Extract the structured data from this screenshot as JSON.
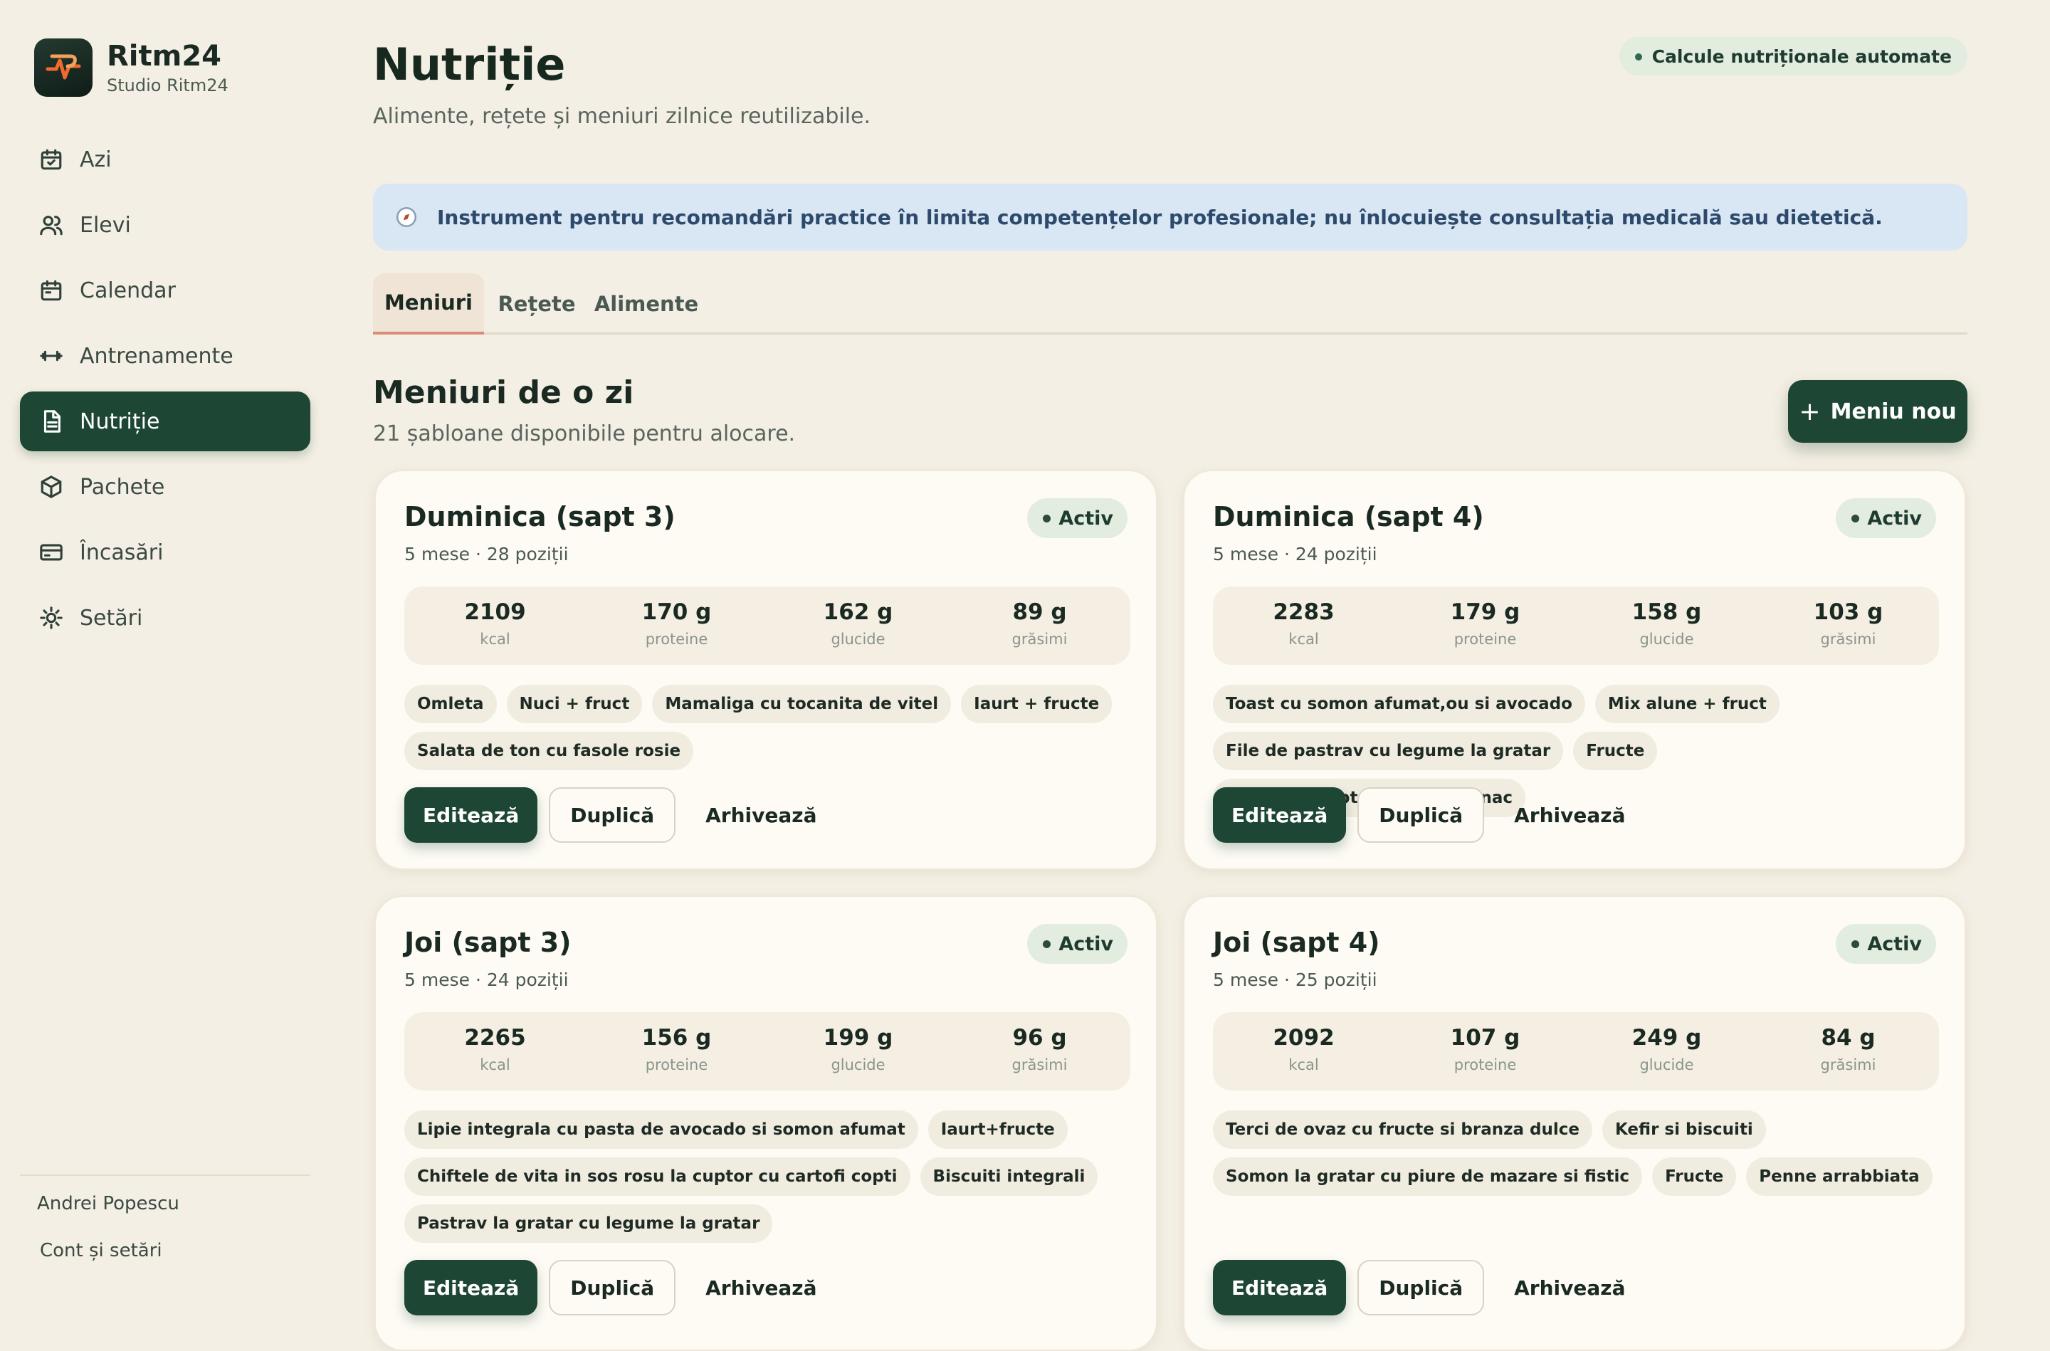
{
  "brand": {
    "name": "Ritm24",
    "subtitle": "Studio Ritm24"
  },
  "sidebar": {
    "items": [
      {
        "label": "Azi",
        "icon": "calendar-check-icon"
      },
      {
        "label": "Elevi",
        "icon": "users-icon"
      },
      {
        "label": "Calendar",
        "icon": "calendar-icon"
      },
      {
        "label": "Antrenamente",
        "icon": "dumbbell-icon"
      },
      {
        "label": "Nutriție",
        "icon": "document-icon",
        "active": true
      },
      {
        "label": "Pachete",
        "icon": "package-icon"
      },
      {
        "label": "Încasări",
        "icon": "credit-card-icon"
      },
      {
        "label": "Setări",
        "icon": "sun-gear-icon"
      }
    ],
    "user_name": "Andrei Popescu",
    "account_link": "Cont și setări"
  },
  "header": {
    "title": "Nutriție",
    "subtitle": "Alimente, rețete și meniuri zilnice reutilizabile.",
    "badge": "Calcule nutriționale automate"
  },
  "notice": {
    "text": "Instrument pentru recomandări practice în limita competențelor profesionale; nu înlocuiește consultația medicală sau dietetică."
  },
  "tabs": [
    {
      "label": "Meniuri",
      "active": true
    },
    {
      "label": "Rețete"
    },
    {
      "label": "Alimente"
    }
  ],
  "section": {
    "title": "Meniuri de o zi",
    "subtitle": "21 șabloane disponibile pentru alocare.",
    "new_button": "Meniu nou",
    "new_button_icon": "+"
  },
  "stat_labels": {
    "kcal": "kcal",
    "protein": "proteine",
    "carbs": "glucide",
    "fat": "grăsimi"
  },
  "actions": {
    "edit": "Editează",
    "duplicate": "Duplică",
    "archive": "Arhivează"
  },
  "menus": [
    {
      "title": "Duminica (sapt 3)",
      "meta": "5 mese · 28 poziții",
      "status": "Activ",
      "kcal": "2109",
      "protein": "170 g",
      "carbs": "162 g",
      "fat": "89 g",
      "meals": [
        "Omleta",
        "Nuci + fruct",
        "Mamaliga cu tocanita de vitel",
        "Iaurt + fructe",
        "Salata de ton cu fasole rosie"
      ]
    },
    {
      "title": "Duminica (sapt 4)",
      "meta": "5 mese · 24 poziții",
      "status": "Activ",
      "kcal": "2283",
      "protein": "179 g",
      "carbs": "158 g",
      "fat": "103 g",
      "meals": [
        "Toast cu somon afumat,ou si avocado",
        "Mix alune + fruct",
        "File de pastrav cu legume la gratar",
        "Fructe",
        "Paste cu piept de pui si spanac"
      ]
    },
    {
      "title": "Joi (sapt 3)",
      "meta": "5 mese · 24 poziții",
      "status": "Activ",
      "kcal": "2265",
      "protein": "156 g",
      "carbs": "199 g",
      "fat": "96 g",
      "meals": [
        "Lipie integrala cu pasta de avocado si somon afumat",
        "Iaurt+fructe",
        "Chiftele de vita in sos rosu la cuptor cu cartofi copti",
        "Biscuiti integrali",
        "Pastrav la gratar cu legume la gratar"
      ]
    },
    {
      "title": "Joi (sapt 4)",
      "meta": "5 mese · 25 poziții",
      "status": "Activ",
      "kcal": "2092",
      "protein": "107 g",
      "carbs": "249 g",
      "fat": "84 g",
      "meals": [
        "Terci de ovaz cu fructe si branza dulce",
        "Kefir si biscuiti",
        "Somon la gratar cu piure de mazare si fistic",
        "Fructe",
        "Penne arrabbiata"
      ]
    }
  ]
}
